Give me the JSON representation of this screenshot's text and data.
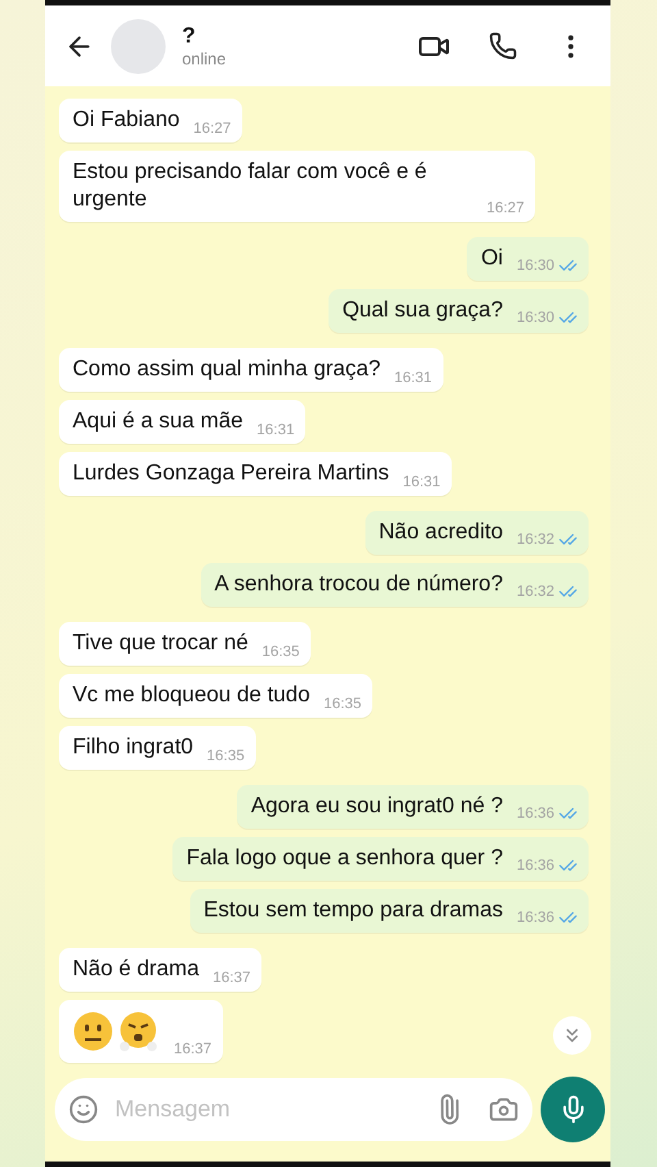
{
  "header": {
    "name": "?",
    "status": "online"
  },
  "messages": [
    {
      "kind": "text",
      "sent": false,
      "text": "Oi Fabiano",
      "time": "16:27"
    },
    {
      "kind": "text",
      "sent": false,
      "text": "Estou precisando falar com você e é urgente",
      "time": "16:27"
    },
    {
      "kind": "text",
      "sent": true,
      "text": "Oi",
      "time": "16:30",
      "read": true
    },
    {
      "kind": "text",
      "sent": true,
      "text": "Qual sua graça?",
      "time": "16:30",
      "read": true
    },
    {
      "kind": "text",
      "sent": false,
      "text": "Como assim qual minha graça?",
      "time": "16:31"
    },
    {
      "kind": "text",
      "sent": false,
      "text": "Aqui é a sua mãe",
      "time": "16:31"
    },
    {
      "kind": "text",
      "sent": false,
      "text": "Lurdes Gonzaga Pereira Martins",
      "time": "16:31"
    },
    {
      "kind": "text",
      "sent": true,
      "text": "Não acredito",
      "time": "16:32",
      "read": true
    },
    {
      "kind": "text",
      "sent": true,
      "text": "A senhora trocou de número?",
      "time": "16:32",
      "read": true
    },
    {
      "kind": "text",
      "sent": false,
      "text": "Tive que trocar né",
      "time": "16:35"
    },
    {
      "kind": "text",
      "sent": false,
      "text": "Vc me bloqueou de tudo",
      "time": "16:35"
    },
    {
      "kind": "text",
      "sent": false,
      "text": "Filho ingrat0",
      "time": "16:35"
    },
    {
      "kind": "text",
      "sent": true,
      "text": "Agora eu sou ingrat0 né ?",
      "time": "16:36",
      "read": true
    },
    {
      "kind": "text",
      "sent": true,
      "text": "Fala logo oque a senhora quer ?",
      "time": "16:36",
      "read": true
    },
    {
      "kind": "text",
      "sent": true,
      "text": "Estou sem tempo para dramas",
      "time": "16:36",
      "read": true
    },
    {
      "kind": "text",
      "sent": false,
      "text": "Não é drama",
      "time": "16:37"
    },
    {
      "kind": "emoji",
      "sent": false,
      "time": "16:37"
    }
  ],
  "composer": {
    "placeholder": "Mensagem"
  }
}
